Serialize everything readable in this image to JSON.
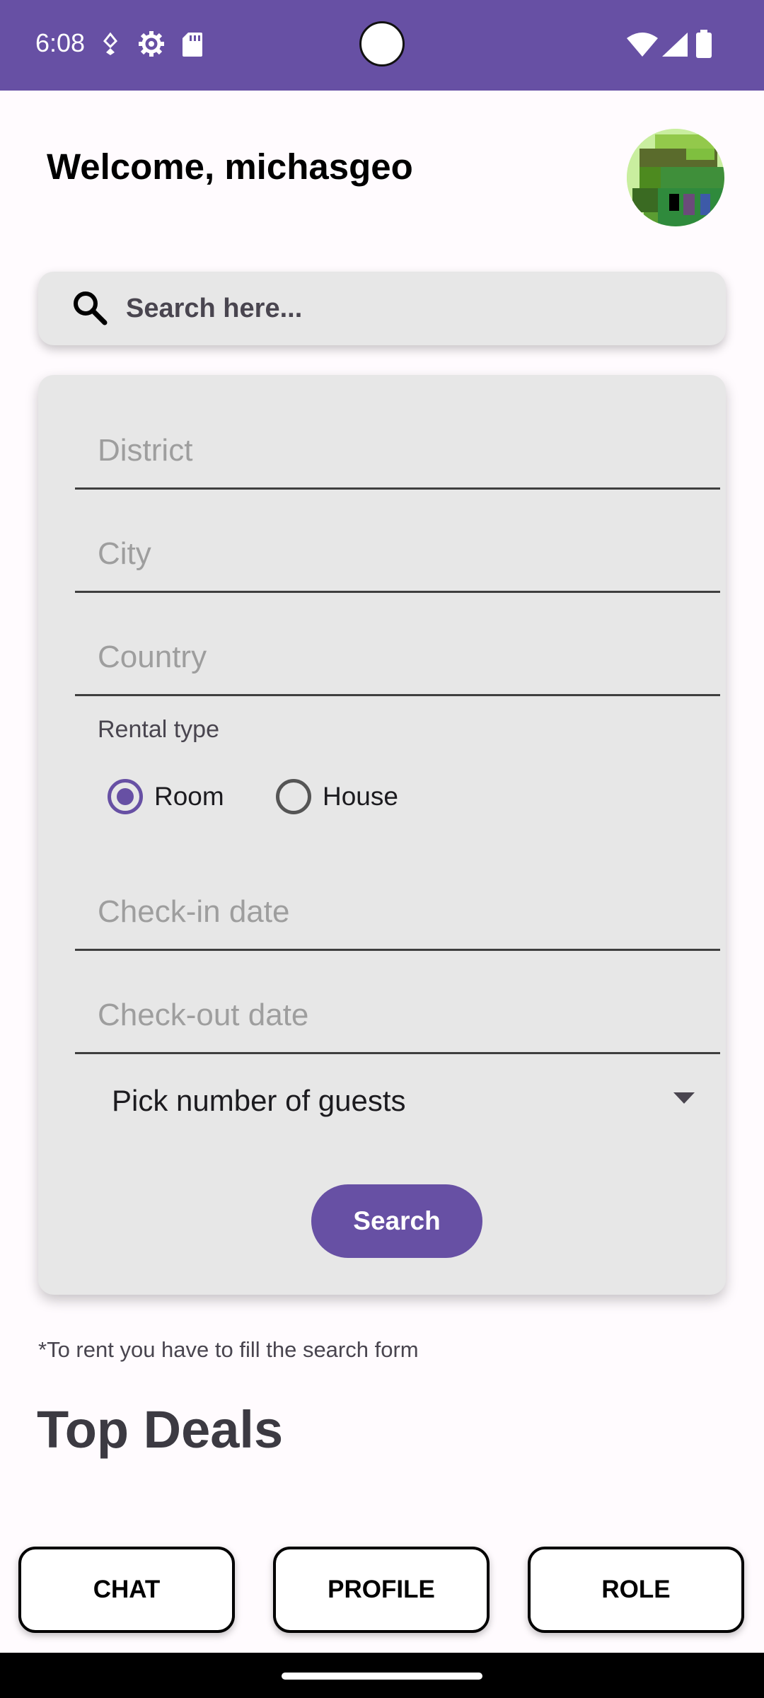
{
  "status_bar": {
    "time": "6:08",
    "icons": [
      "notification-dot-icon",
      "settings-gear-icon",
      "sd-card-icon",
      "wifi-icon",
      "cellular-signal-icon",
      "battery-icon"
    ],
    "background_color": "#6750a4"
  },
  "header": {
    "welcome_text": "Welcome, michasgeo",
    "avatar": "avatar"
  },
  "search": {
    "placeholder": "Search here...",
    "icon": "search-icon"
  },
  "form": {
    "district_placeholder": "District",
    "city_placeholder": "City",
    "country_placeholder": "Country",
    "rental_type_label": "Rental type",
    "rental_options": [
      {
        "label": "Room",
        "selected": true
      },
      {
        "label": "House",
        "selected": false
      }
    ],
    "checkin_placeholder": "Check-in date",
    "checkout_placeholder": "Check-out date",
    "guests_select": "Pick number of guests",
    "search_button": "Search"
  },
  "note": "*To rent you have to fill the search form",
  "top_deals_title": "Top Deals",
  "bottom_nav": {
    "chat": "CHAT",
    "profile": "PROFILE",
    "role": "ROLE"
  },
  "colors": {
    "accent": "#6750a4",
    "card_background": "#e7e7e7",
    "page_background": "#fffbfe"
  }
}
